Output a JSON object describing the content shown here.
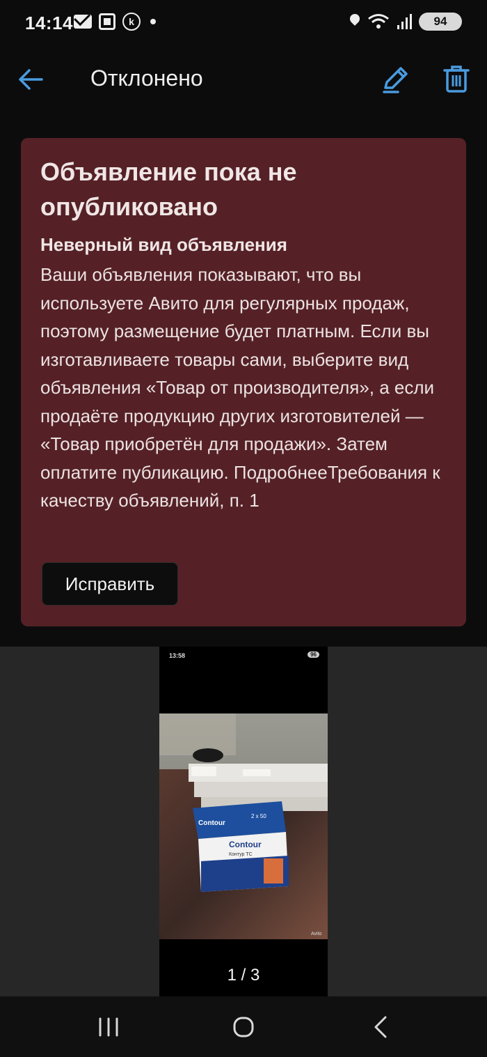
{
  "status_bar": {
    "time": "14:14",
    "battery": "94",
    "icons": [
      "mail-icon",
      "screenshot-icon",
      "k-icon",
      "dot-icon",
      "location-icon",
      "wifi-icon",
      "signal-icon",
      "battery-icon"
    ]
  },
  "app_bar": {
    "title": "Отклонено",
    "back_icon": "arrow-left-icon",
    "edit_icon": "pencil-icon",
    "delete_icon": "trash-icon",
    "accent_color": "#4a9bdf"
  },
  "rejection_card": {
    "title": "Объявление пока не опубликовано",
    "subtitle": "Неверный вид объявления",
    "body": "Ваши объявления показывают, что вы используете Авито для регулярных продаж, поэтому размещение будет платным. Если вы изготавливаете товары сами, выберите вид объявления «Товар от производителя», а если продаёте продукцию других изготовителей — «Товар приобретён для продажи». Затем оплатите публикацию. ПодробнееТребования к качеству объявлений, п. 1",
    "fix_button": "Исправить",
    "background_color": "#552126"
  },
  "gallery": {
    "counter": "1 / 3",
    "current": 1,
    "total": 3,
    "photo_status_time": "13:58",
    "photo_status_battery": "96",
    "photo_description": "Screenshot of boxes of Contour TS test strips on a table",
    "photo_box_brand": "Contour",
    "photo_box_sub": "Контур ТС",
    "photo_box_count": "2 x 50",
    "watermark": "Avito"
  },
  "nav_bar": {
    "icons": [
      "recents-icon",
      "home-icon",
      "back-icon"
    ]
  }
}
